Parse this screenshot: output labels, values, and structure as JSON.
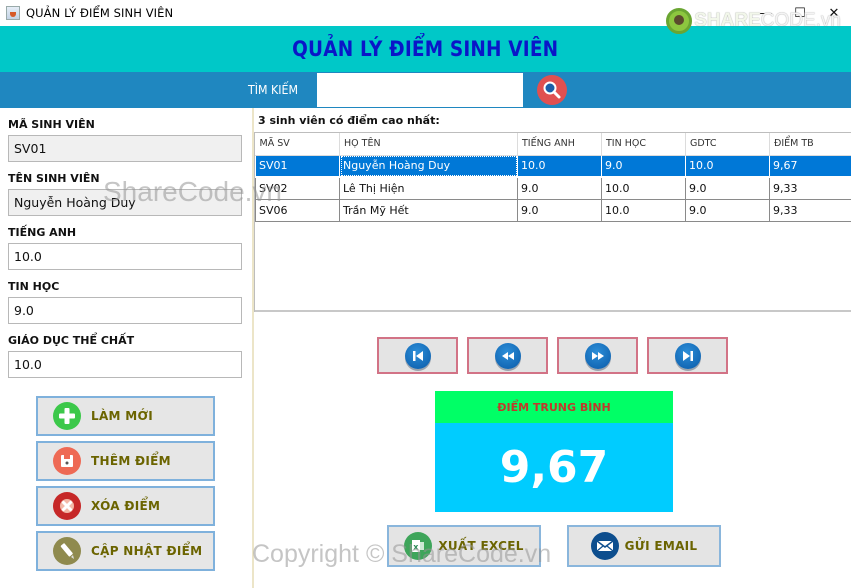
{
  "window": {
    "title": "QUẢN LÝ ĐIỂM SINH VIÊN",
    "controls": {
      "minimize": "—",
      "maximize": "☐",
      "close": "✕"
    },
    "brand": {
      "part1": "SHARE",
      "part2": "CODE.vn"
    }
  },
  "header": {
    "title": "QUẢN LÝ ĐIỂM SINH VIÊN"
  },
  "search": {
    "label": "TÌM KIẾM",
    "value": "",
    "placeholder": ""
  },
  "form": {
    "student_id": {
      "label": "MÃ SINH VIÊN",
      "value": "SV01"
    },
    "student_name": {
      "label": "TÊN SINH VIÊN",
      "value": "Nguyễn Hoàng Duy"
    },
    "english": {
      "label": "TIẾNG ANH",
      "value": "10.0"
    },
    "informatics": {
      "label": "TIN HỌC",
      "value": "9.0"
    },
    "pe": {
      "label": "GIÁO DỤC THỂ CHẤT",
      "value": "10.0"
    }
  },
  "actions": {
    "refresh": {
      "label": "LÀM MỚI",
      "icon": "plus-icon",
      "color": "#3cc84a"
    },
    "add": {
      "label": "THÊM ĐIỂM",
      "icon": "floppy-icon",
      "color": "#ee6a55"
    },
    "delete": {
      "label": "XÓA ĐIỂM",
      "icon": "x-circle-icon",
      "color": "#c62828"
    },
    "update": {
      "label": "CẬP NHẬT ĐIỂM",
      "icon": "pencil-icon",
      "color": "#8f8a4e"
    }
  },
  "table": {
    "title": "3 sinh viên có điểm cao nhất:",
    "columns": [
      "MÃ SV",
      "HỌ TÊN",
      "TIẾNG ANH",
      "TIN HỌC",
      "GDTC",
      "ĐIỂM TB"
    ],
    "rows": [
      [
        "SV01",
        "Nguyễn Hoàng Duy",
        "10.0",
        "9.0",
        "10.0",
        "9,67"
      ],
      [
        "SV02",
        "Lê Thị Hiện",
        "9.0",
        "10.0",
        "9.0",
        "9,33"
      ],
      [
        "SV06",
        "Trần Mỹ Hết",
        "9.0",
        "10.0",
        "9.0",
        "9,33"
      ]
    ],
    "selected_row": 0
  },
  "navigation": [
    "first-icon",
    "previous-icon",
    "next-icon",
    "last-icon"
  ],
  "average": {
    "label": "ĐIỂM TRUNG BÌNH",
    "value": "9,67"
  },
  "bottom": {
    "export": {
      "label": "XUẤT EXCEL"
    },
    "email": {
      "label": "GỬI EMAIL"
    }
  },
  "watermarks": {
    "center": "ShareCode.vn",
    "bottom": "Copyright © ShareCode.vn"
  },
  "colors": {
    "header_bg": "#00c8c8",
    "header_title": "#0a16c8",
    "search_band": "#1f87c0",
    "selection": "#0078d7",
    "avg_head": "#00ff66",
    "avg_body": "#00ccff",
    "button_text": "#6b6400"
  }
}
